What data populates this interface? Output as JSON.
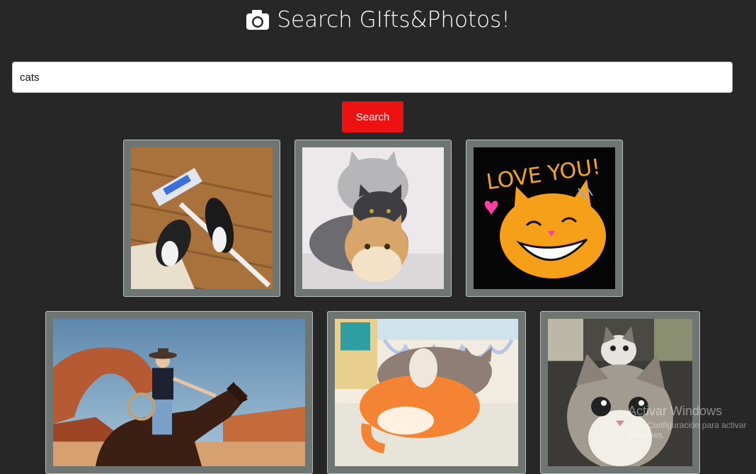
{
  "header": {
    "icon": "camera-icon",
    "title": "Search GIfts&Photos!"
  },
  "search": {
    "value": "cats",
    "button_label": "Search"
  },
  "results": [
    {
      "name": "gif-cats-mop",
      "icon": "image"
    },
    {
      "name": "gif-cats-stacked",
      "icon": "image"
    },
    {
      "name": "gif-love-you-cat",
      "text": "LOVE YOU!"
    },
    {
      "name": "gif-cowgirl-horse",
      "icon": "image"
    },
    {
      "name": "gif-orange-cat-cuddle",
      "icon": "image"
    },
    {
      "name": "gif-surprised-kittens",
      "icon": "image"
    }
  ],
  "watermark": {
    "line1": "Activar Windows",
    "line2": "Ve a Configuración para activar Windows."
  },
  "colors": {
    "background": "#272727",
    "button": "#ee1111",
    "card": "#6e7572"
  }
}
